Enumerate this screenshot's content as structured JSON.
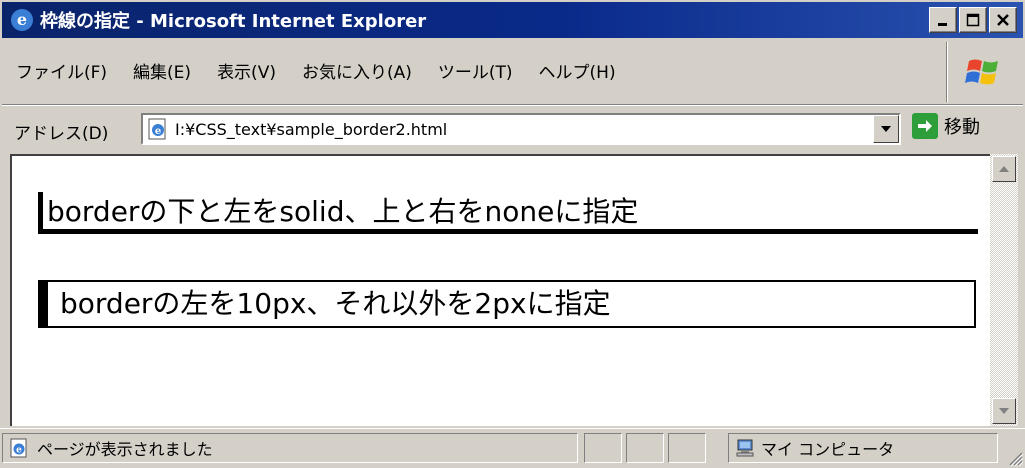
{
  "window": {
    "title": "枠線の指定 - Microsoft Internet Explorer"
  },
  "menu": {
    "items": [
      "ファイル(F)",
      "編集(E)",
      "表示(V)",
      "お気に入り(A)",
      "ツール(T)",
      "ヘルプ(H)"
    ]
  },
  "address": {
    "label": "アドレス(D)",
    "url": "I:¥CSS_text¥sample_border2.html",
    "go_label": "移動"
  },
  "content": {
    "sample1_text": "borderの下と左をsolid、上と右をnoneに指定",
    "sample2_text": "borderの左を10px、それ以外を2pxに指定"
  },
  "status": {
    "text": "ページが表示されました",
    "zone": "マイ コンピュータ"
  },
  "colors": {
    "title_bar": "#0a246a",
    "chrome": "#d4d0c8",
    "go_button": "#2e9e3a"
  }
}
